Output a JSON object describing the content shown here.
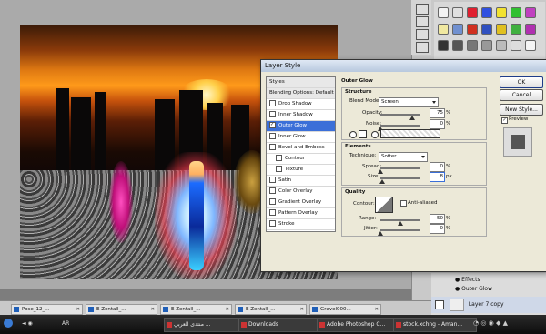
{
  "dialog": {
    "title": "Layer Style",
    "styles_list": [
      {
        "label": "Styles",
        "type": "head",
        "checked": false
      },
      {
        "label": "Blending Options: Default",
        "type": "head",
        "checked": false
      },
      {
        "label": "Drop Shadow",
        "type": "item",
        "checked": false
      },
      {
        "label": "Inner Shadow",
        "type": "item",
        "checked": false
      },
      {
        "label": "Outer Glow",
        "type": "item",
        "checked": true,
        "selected": true
      },
      {
        "label": "Inner Glow",
        "type": "item",
        "checked": false
      },
      {
        "label": "Bevel and Emboss",
        "type": "item",
        "checked": false
      },
      {
        "label": "Contour",
        "type": "sub",
        "checked": false
      },
      {
        "label": "Texture",
        "type": "sub",
        "checked": false
      },
      {
        "label": "Satin",
        "type": "item",
        "checked": false
      },
      {
        "label": "Color Overlay",
        "type": "item",
        "checked": false
      },
      {
        "label": "Gradient Overlay",
        "type": "item",
        "checked": false
      },
      {
        "label": "Pattern Overlay",
        "type": "item",
        "checked": false
      },
      {
        "label": "Stroke",
        "type": "item",
        "checked": false
      }
    ],
    "outer_glow": {
      "title": "Outer Glow",
      "structure_title": "Structure",
      "blend_mode_label": "Blend Mode:",
      "blend_mode_value": "Screen",
      "opacity_label": "Opacity:",
      "opacity_value": "75",
      "noise_label": "Noise:",
      "noise_value": "0",
      "percent": "%",
      "elements_title": "Elements",
      "technique_label": "Technique:",
      "technique_value": "Softer",
      "spread_label": "Spread:",
      "spread_value": "0",
      "size_label": "Size:",
      "size_value": "8",
      "px": "px",
      "quality_title": "Quality",
      "contour_label": "Contour:",
      "anti_aliased_label": "Anti-aliased",
      "range_label": "Range:",
      "range_value": "50",
      "jitter_label": "Jitter:",
      "jitter_value": "0"
    },
    "buttons": {
      "ok": "OK",
      "cancel": "Cancel",
      "new_style": "New Style...",
      "preview": "Preview"
    }
  },
  "layers": {
    "effects_label": "Effects",
    "outer_glow_label": "Outer Glow",
    "layer_name": "Layer 7 copy"
  },
  "doc_tabs": [
    {
      "label": "Pose_12_..."
    },
    {
      "label": "E Zentall_..."
    },
    {
      "label": "E Zentall_..."
    },
    {
      "label": "E Zentall_..."
    },
    {
      "label": "Gravel000..."
    }
  ],
  "taskbar": {
    "lang": "AR",
    "items": [
      {
        "label": "منتدى العربي ..."
      },
      {
        "label": "Downloads"
      },
      {
        "label": "Adobe Photoshop C..."
      },
      {
        "label": "stock.xchng - Aman..."
      }
    ]
  },
  "colors": {
    "accent": "#3b6fd8",
    "dialog_bg": "#ece9d8",
    "taskbar_bg": "#111111"
  }
}
